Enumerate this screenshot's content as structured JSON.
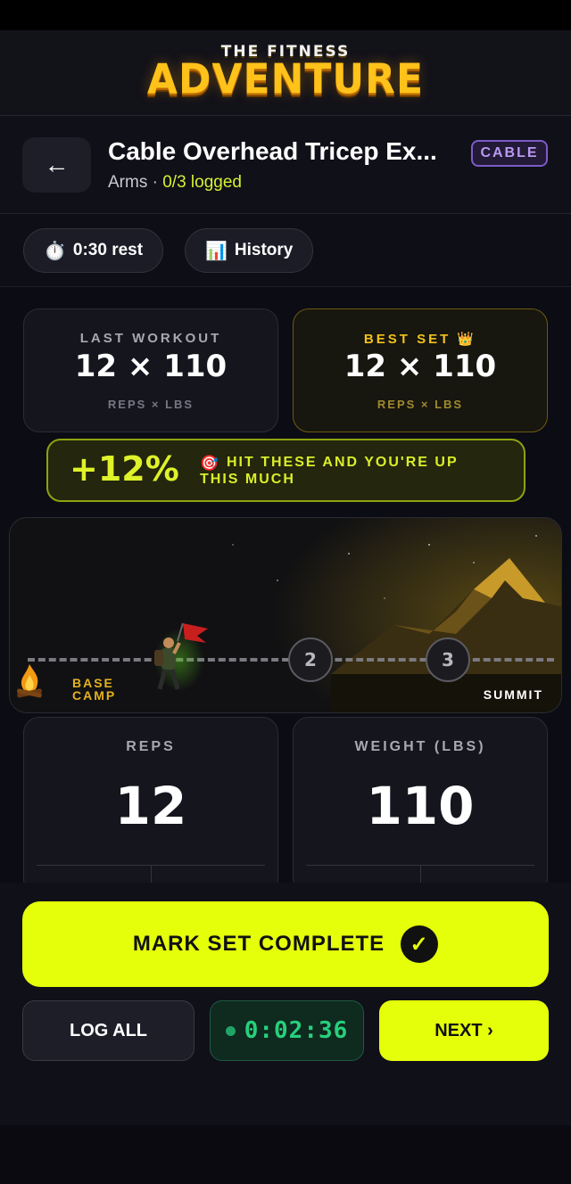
{
  "app": {
    "logo_top": "THE FITNESS",
    "logo_main": "ADVENTURE"
  },
  "exercise": {
    "title": "Cable Overhead Tricep Ex...",
    "muscle": "Arms",
    "separator": " · ",
    "logged": "0/3 logged",
    "equipment_badge": "CABLE",
    "back_icon": "arrow-left-icon"
  },
  "chips": {
    "rest": {
      "icon": "stopwatch-icon",
      "label": "0:30 rest"
    },
    "history": {
      "icon": "bar-chart-icon",
      "label": "History"
    }
  },
  "stats": {
    "last": {
      "label": "LAST WORKOUT",
      "value": "12 × 110",
      "unit": "REPS × LBS"
    },
    "best": {
      "label": "BEST SET 👑",
      "value": "12 × 110",
      "unit": "REPS × LBS"
    }
  },
  "boost": {
    "percent": "+12%",
    "icon": "target-icon",
    "text": "HIT THESE AND YOU'RE UP THIS MUCH"
  },
  "journey": {
    "start_label_line1": "BASE",
    "start_label_line2": "CAMP",
    "end_label": "SUMMIT",
    "milestones": [
      "2",
      "3"
    ],
    "current_set": 1,
    "total_sets": 3
  },
  "inputs": {
    "reps": {
      "label": "REPS",
      "value": "12"
    },
    "weight": {
      "label": "WEIGHT (LBS)",
      "value": "110"
    }
  },
  "actions": {
    "complete_label": "MARK SET COMPLETE",
    "complete_icon": "check-circle-icon",
    "log_all_label": "LOG ALL",
    "timer": "0:02:36",
    "next_label": "NEXT ›"
  },
  "colors": {
    "accent": "#e5ff0a",
    "gold": "#ffc21a",
    "badge_purple": "#7d5bc7",
    "timer_green": "#27d07c"
  }
}
